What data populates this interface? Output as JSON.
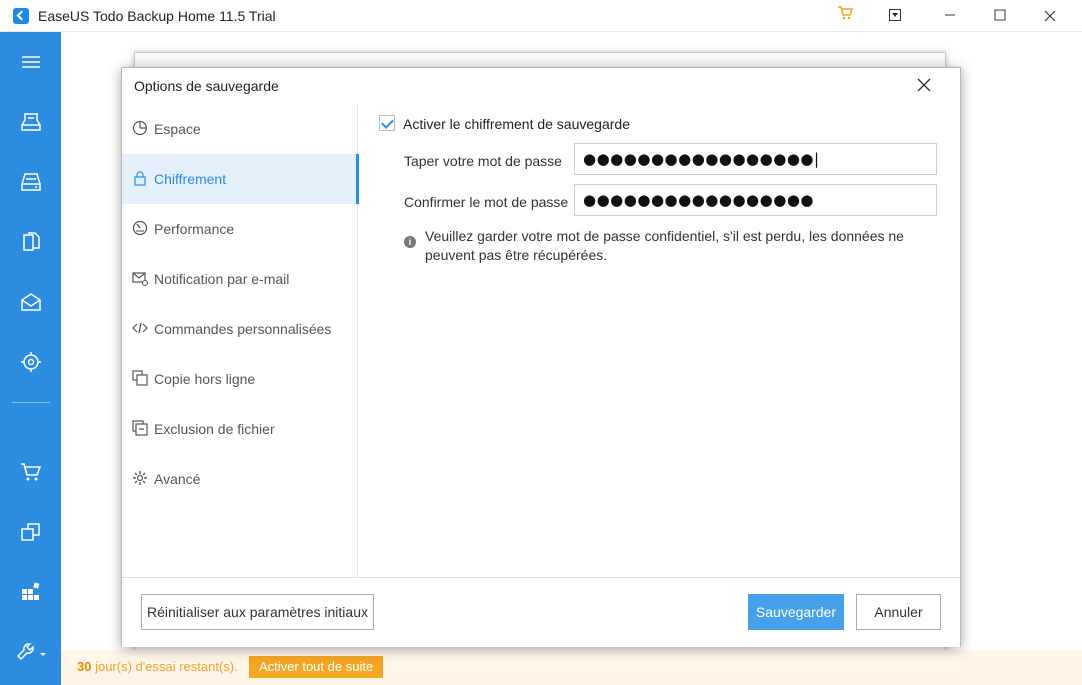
{
  "window": {
    "title": "EaseUS Todo Backup Home 11.5 Trial",
    "icons": [
      "cart-icon",
      "dropdown-icon",
      "minimize-icon",
      "maximize-icon",
      "close-icon"
    ]
  },
  "sidebar": {
    "icons": [
      "menu-icon",
      "disk-backup-icon",
      "system-backup-icon",
      "file-backup-icon",
      "mail-backup-icon",
      "smart-backup-icon",
      "cart-icon",
      "clone-icon",
      "tools-grid-icon",
      "wrench-icon"
    ]
  },
  "trial": {
    "days": "30",
    "text": " jour(s) d'essai restant(s).",
    "button": "Activer tout de suite"
  },
  "dialog": {
    "title": "Options de sauvegarde",
    "nav": [
      {
        "label": "Espace",
        "icon": "pie-chart-icon"
      },
      {
        "label": "Chiffrement",
        "icon": "lock-icon",
        "active": true
      },
      {
        "label": "Performance",
        "icon": "gauge-icon"
      },
      {
        "label": "Notification par e-mail",
        "icon": "mail-bell-icon"
      },
      {
        "label": "Commandes personnalisées",
        "icon": "code-icon"
      },
      {
        "label": "Copie hors ligne",
        "icon": "copy-icon"
      },
      {
        "label": "Exclusion de fichier",
        "icon": "exclude-file-icon"
      },
      {
        "label": "Avancé",
        "icon": "gear-icon"
      }
    ],
    "encryption": {
      "enable_label": "Activer le chiffrement de sauvegarde",
      "enabled": true,
      "password_label": "Taper votre mot de passe",
      "password_value": "●●●●●●●●●●●●●●●●●|",
      "confirm_label": "Confirmer le mot de passe",
      "confirm_value": "●●●●●●●●●●●●●●●●●",
      "info": "Veuillez garder votre mot de passe confidentiel, s'il est perdu, les données ne peuvent pas être récupérées."
    },
    "buttons": {
      "reset": "Réinitialiser aux paramètres initiaux",
      "save": "Sauvegarder",
      "cancel": "Annuler"
    }
  },
  "colors": {
    "accent": "#2c8ce0",
    "save_button": "#46a0ea",
    "trial": "#f5a623"
  }
}
